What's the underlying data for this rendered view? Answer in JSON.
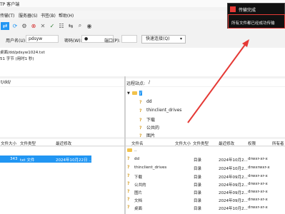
{
  "titlebar": {
    "title": "TP 客户端"
  },
  "menubar": {
    "items": [
      "传输(T)",
      "服务器(S)",
      "书签(B)",
      "帮助(H)"
    ]
  },
  "quickconnect": {
    "username_label": "用户名(U):",
    "username_value": "pdsyw",
    "password_label": "密码(W):",
    "password_value": "●",
    "port_label": "端口(P):",
    "port_value": "",
    "button_label": "快速连接(Q)"
  },
  "log": {
    "lines": [
      "桌面/dd/pdsyw1024.txt",
      "51 字节 (用时1 秒)"
    ]
  },
  "local": {
    "path_value": "t/dd/",
    "header": {
      "size": "文件大小",
      "type": "文件类型",
      "modified": "最近修改"
    },
    "files": [
      {
        "size": "343",
        "type": "txt 文件",
        "modified": "2024年10月22日 ..."
      }
    ]
  },
  "remote": {
    "site_label": "远程站点:",
    "site_value": "/",
    "tree": [
      {
        "name": "/"
      },
      {
        "name": "dd"
      },
      {
        "name": "thinclient_drives"
      },
      {
        "name": "下载"
      },
      {
        "name": "公共的"
      },
      {
        "name": "图片"
      }
    ],
    "header": {
      "name": "文件名",
      "size": "文件大小",
      "type": "文件类型",
      "modified": "最近修改",
      "perm": "权限",
      "owner": "所有者"
    },
    "files": [
      {
        "name": "..",
        "size": "",
        "type": "",
        "modified": "",
        "perm": "",
        "owner": ""
      },
      {
        "name": "dd",
        "size": "",
        "type": "目录",
        "modified": "2024年10月2...",
        "perm": "drwxr-xr-x",
        "owner": ""
      },
      {
        "name": "thinclient_drives",
        "size": "",
        "type": "目录",
        "modified": "2024年10月2...",
        "perm": "drwxrwxr-x",
        "owner": ""
      },
      {
        "name": "下载",
        "size": "",
        "type": "目录",
        "modified": "2024年09月2...",
        "perm": "drwxr-xr-x",
        "owner": ""
      },
      {
        "name": "公共的",
        "size": "",
        "type": "目录",
        "modified": "2024年09月2...",
        "perm": "drwxr-xr-x",
        "owner": ""
      },
      {
        "name": "图片",
        "size": "",
        "type": "目录",
        "modified": "2024年09月2...",
        "perm": "drwxr-xr-x",
        "owner": ""
      },
      {
        "name": "文档",
        "size": "",
        "type": "目录",
        "modified": "2024年09月2...",
        "perm": "drwxr-xr-x",
        "owner": ""
      },
      {
        "name": "桌面",
        "size": "",
        "type": "目录",
        "modified": "2024年10月2...",
        "perm": "drwxr-xr-x",
        "owner": ""
      }
    ]
  },
  "toast": {
    "title": "传输完成",
    "message": "所有文件都已经成功传输"
  },
  "colors": {
    "accent": "#2196f3",
    "highlight": "#e53935",
    "toast_bg": "#111111"
  }
}
